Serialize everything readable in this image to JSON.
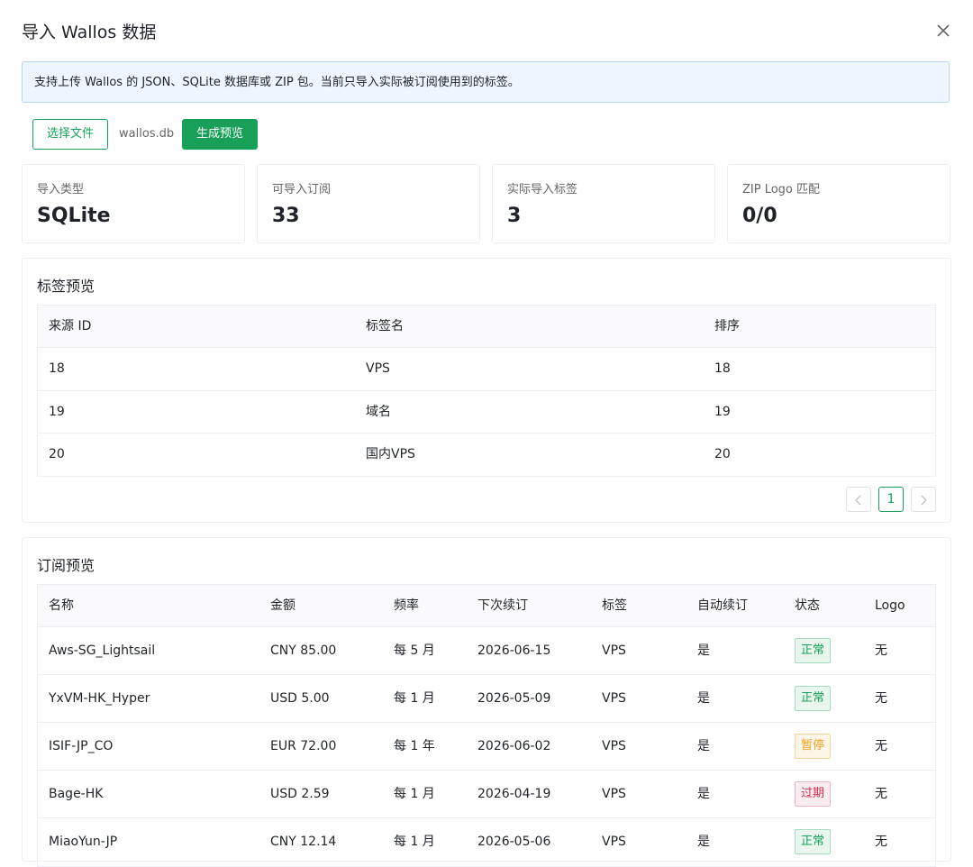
{
  "dialog": {
    "title": "导入 Wallos 数据",
    "info": "支持上传 Wallos 的 JSON、SQLite 数据库或 ZIP 包。当前只导入实际被订阅使用到的标签。",
    "choose_file_label": "选择文件",
    "file_name": "wallos.db",
    "preview_button_label": "生成预览"
  },
  "stats": [
    {
      "label": "导入类型",
      "value": "SQLite"
    },
    {
      "label": "可导入订阅",
      "value": "33"
    },
    {
      "label": "实际导入标签",
      "value": "3"
    },
    {
      "label": "ZIP Logo 匹配",
      "value": "0/0"
    }
  ],
  "tag_preview": {
    "title": "标签预览",
    "columns": [
      "来源 ID",
      "标签名",
      "排序"
    ],
    "rows": [
      [
        "18",
        "VPS",
        "18"
      ],
      [
        "19",
        "域名",
        "19"
      ],
      [
        "20",
        "国内VPS",
        "20"
      ]
    ],
    "pagination": {
      "current_page": "1",
      "prev_icon": "chevron-left",
      "next_icon": "chevron-right"
    }
  },
  "sub_preview": {
    "title": "订阅预览",
    "columns": [
      "名称",
      "金额",
      "频率",
      "下次续订",
      "标签",
      "自动续订",
      "状态",
      "Logo"
    ],
    "rows": [
      {
        "name": "Aws-SG_Lightsail",
        "amount": "CNY 85.00",
        "freq": "每 5 月",
        "next": "2026-06-15",
        "tag": "VPS",
        "auto": "是",
        "status": "正常",
        "status_type": "ok",
        "logo": "无"
      },
      {
        "name": "YxVM-HK_Hyper",
        "amount": "USD 5.00",
        "freq": "每 1 月",
        "next": "2026-05-09",
        "tag": "VPS",
        "auto": "是",
        "status": "正常",
        "status_type": "ok",
        "logo": "无"
      },
      {
        "name": "ISIF-JP_CO",
        "amount": "EUR 72.00",
        "freq": "每 1 年",
        "next": "2026-06-02",
        "tag": "VPS",
        "auto": "是",
        "status": "暂停",
        "status_type": "paused",
        "logo": "无"
      },
      {
        "name": "Bage-HK",
        "amount": "USD 2.59",
        "freq": "每 1 月",
        "next": "2026-04-19",
        "tag": "VPS",
        "auto": "是",
        "status": "过期",
        "status_type": "expired",
        "logo": "无"
      },
      {
        "name": "MiaoYun-JP",
        "amount": "CNY 12.14",
        "freq": "每 1 月",
        "next": "2026-05-06",
        "tag": "VPS",
        "auto": "是",
        "status": "正常",
        "status_type": "ok",
        "logo": "无"
      }
    ]
  },
  "colors": {
    "primary": "#18a058",
    "info_bg": "#edf5fe",
    "warning": "#f0a020",
    "error": "#d03050"
  }
}
